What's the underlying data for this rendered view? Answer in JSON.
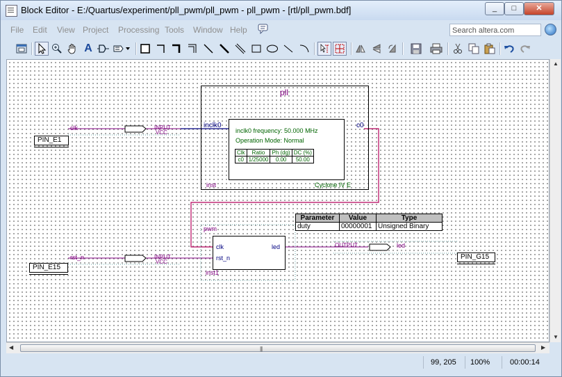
{
  "window": {
    "title": "Block Editor - E:/Quartus/experiment/pll_pwm/pll_pwm - pll_pwm - [rtl/pll_pwm.bdf]",
    "buttons": {
      "minimize": "_",
      "maximize": "□",
      "close": "✕"
    }
  },
  "menu": {
    "items": [
      "File",
      "Edit",
      "View",
      "Project",
      "Processing",
      "Tools",
      "Window",
      "Help"
    ],
    "search_placeholder": "Search altera.com"
  },
  "toolbar": {
    "icons": [
      "detach-icon",
      "selection-tool-icon",
      "zoom-icon",
      "hand-icon",
      "text-tool-icon",
      "symbol-tool-icon",
      "pin-tool-icon",
      "rectangle-block-icon",
      "orthogonal-node-icon",
      "orthogonal-bus-icon",
      "orthogonal-conduit-icon",
      "diagonal-node-icon",
      "diagonal-bus-icon",
      "diagonal-conduit-icon",
      "rectangle-icon",
      "oval-icon",
      "line-icon",
      "arc-icon",
      "partial-line-select-icon",
      "rubberbanding-icon",
      "flip-horizontal-icon",
      "flip-vertical-icon",
      "rotate-icon",
      "save-icon",
      "print-icon",
      "cut-icon",
      "copy-icon",
      "paste-icon",
      "undo-icon",
      "redo-icon"
    ],
    "text_tool_glyph": "A"
  },
  "schematic": {
    "pll": {
      "title": "pll",
      "port_in": "inclk0",
      "port_out": "c0",
      "freq": "inclk0 frequency: 50.000 MHz",
      "mode": "Operation Mode: Normal",
      "table_headers": [
        "Clk",
        "Ratio",
        "Ph (dg)",
        "DC (%)"
      ],
      "table_row": [
        "c0",
        "1/25000",
        "0.00",
        "50.00"
      ],
      "inst": "inst",
      "device": "Cyclone IV E"
    },
    "pwm": {
      "title": "pwm",
      "ports_in": [
        "clk",
        "rst_n"
      ],
      "port_out": "led",
      "inst": "inst1"
    },
    "params": {
      "headers": [
        "Parameter",
        "Value",
        "Type"
      ],
      "rows": [
        [
          "duty",
          "00000001",
          "Unsigned Binary"
        ]
      ]
    },
    "pins": {
      "clk": {
        "name": "clk",
        "type": "INPUT",
        "default": "VCC",
        "location": "PIN_E1"
      },
      "rst_n": {
        "name": "rst_n",
        "type": "INPUT",
        "default": "VCC",
        "location": "PIN_E15"
      },
      "led": {
        "name": "led",
        "type": "OUTPUT",
        "location": "PIN_G15"
      }
    },
    "colors": {
      "wire": "#b4005a",
      "pin_wire": "#800080",
      "pll_clk_wire": "#000080"
    }
  },
  "statusbar": {
    "coords": "99, 205",
    "zoom": "100%",
    "time": "00:00:14"
  },
  "scroll": {
    "grip": "|||"
  }
}
